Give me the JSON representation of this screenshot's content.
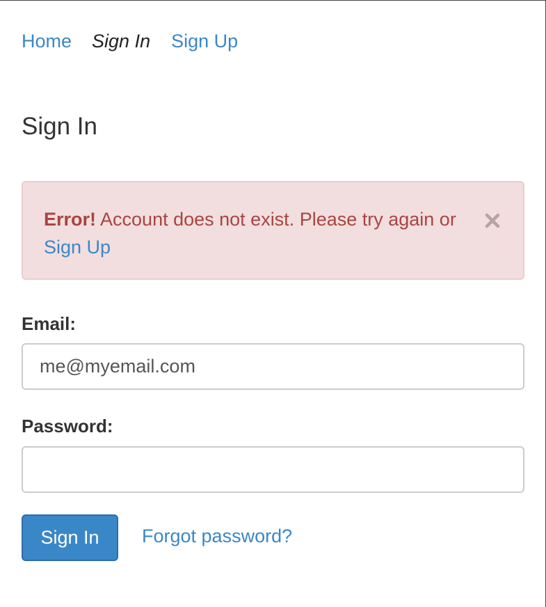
{
  "nav": {
    "home": "Home",
    "sign_in": "Sign In",
    "sign_up": "Sign Up"
  },
  "page": {
    "title": "Sign In"
  },
  "alert": {
    "prefix": "Error!",
    "message": " Account does not exist. Please try again or ",
    "link": "Sign Up",
    "close_icon": "close-icon"
  },
  "form": {
    "email_label": "Email:",
    "email_value": "me@myemail.com",
    "password_label": "Password:",
    "password_value": "",
    "submit_label": "Sign In",
    "forgot_label": "Forgot password?"
  },
  "colors": {
    "link": "#3a87c8",
    "alert_bg": "#f2dede",
    "alert_text": "#a94442",
    "button_bg": "#3a87c8"
  }
}
